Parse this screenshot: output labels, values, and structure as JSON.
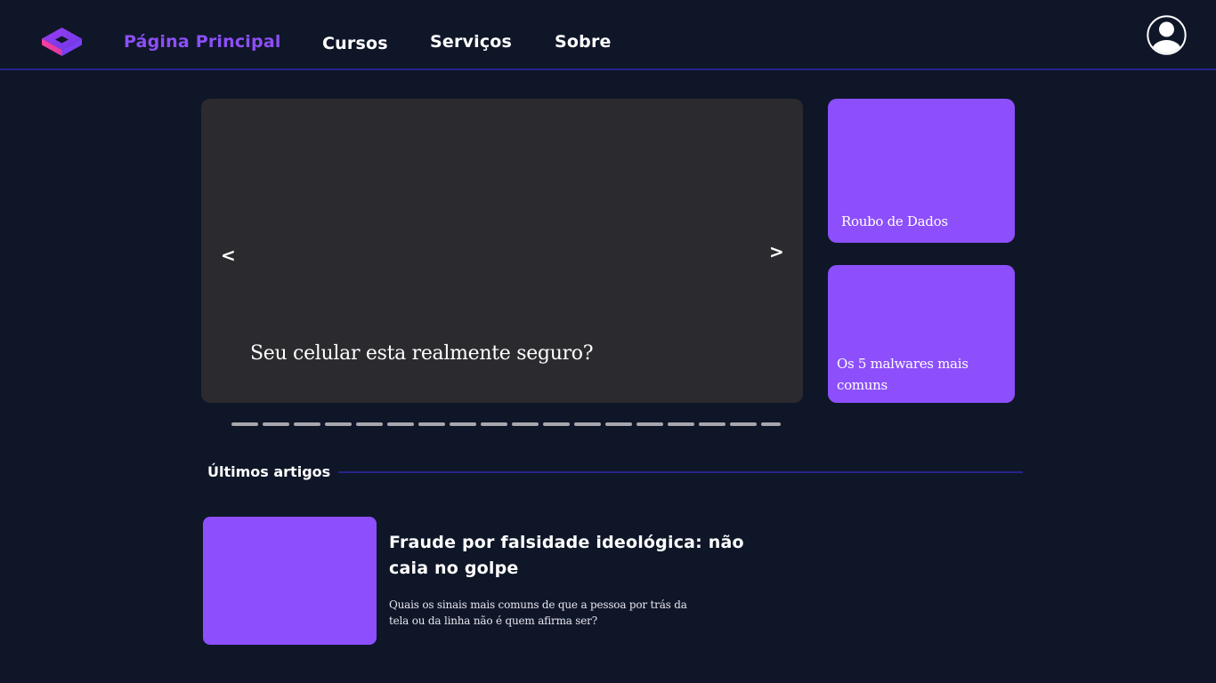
{
  "header": {
    "logo_icon": "cube-logo-icon",
    "nav": [
      {
        "label": "Página Principal",
        "active": true
      },
      {
        "label": "Cursos",
        "active": false
      },
      {
        "label": "Serviços",
        "active": false
      },
      {
        "label": "Sobre",
        "active": false
      }
    ],
    "profile_icon": "user-circle-icon"
  },
  "carousel": {
    "prev_label": "<",
    "next_label": ">",
    "slide_title": "Seu celular esta realmente seguro?",
    "slide_count": 18,
    "active_index": 0,
    "background_color": "#2b2a2e",
    "indicator_color": "#a7a7ad"
  },
  "side_cards": [
    {
      "title": "Roubo de Dados"
    },
    {
      "title": "Os 5 malwares mais comuns"
    }
  ],
  "latest": {
    "heading": "Últimos artigos",
    "articles": [
      {
        "title": "Fraude por falsidade ideológica: não caia no golpe",
        "excerpt": "Quais os sinais mais comuns de que a pessoa por trás da tela ou da linha não é quem afirma ser?"
      }
    ]
  },
  "colors": {
    "background": "#0f1628",
    "accent_purple": "#8c4ffb",
    "active_nav": "#8d4ff7",
    "divider_blue": "#25248a",
    "logo_pink": "#ee3c9a",
    "logo_violet": "#7b3ff2"
  }
}
